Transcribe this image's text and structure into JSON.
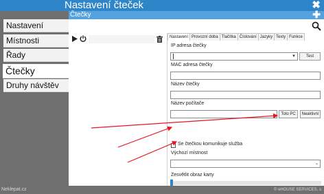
{
  "window": {
    "title": "Nastavení čteček",
    "subtitle": "Čtečky"
  },
  "sidebar": {
    "items": [
      {
        "label": "Nastavení"
      },
      {
        "label": "Místnosti"
      },
      {
        "label": "Řady"
      },
      {
        "label": "Čtečky",
        "active": true
      },
      {
        "label": "Druhy návštěv"
      }
    ]
  },
  "footer": {
    "left": "Neklepat.cz",
    "right": "© eHOUSE SERVICES, s"
  },
  "tabs": [
    "Nastavení",
    "Provozní doba",
    "Tlačítka",
    "Číslování",
    "Jazyky",
    "Texty",
    "Funkce"
  ],
  "form": {
    "ip_label": "IP adresa čtečky",
    "ip_value": "",
    "test_button": "Test",
    "mac_label": "MAC adresa čtečky",
    "mac_value": "",
    "reader_name_label": "Název čtečky",
    "reader_name_value": "",
    "pc_name_label": "Název počítače",
    "pc_name_value": "",
    "to_pc_button": "Toto PC",
    "deactivate_button": "Neaktivní",
    "service_checkbox_label": "Se čtečkou komunikuje služba",
    "service_checked": false,
    "room_label": "Výchozí místnost",
    "room_value": "",
    "brighten_label": "Zesvětlit obraz karty",
    "brighten_level": 0
  },
  "colors": {
    "titlebar": "#2e86c9",
    "subbar": "#55a2e0",
    "annotation": "#e8141e"
  },
  "icons": [
    "close-icon",
    "plus-icon",
    "search-icon",
    "play-icon",
    "power-icon",
    "trash-icon",
    "chevron-down-icon"
  ]
}
